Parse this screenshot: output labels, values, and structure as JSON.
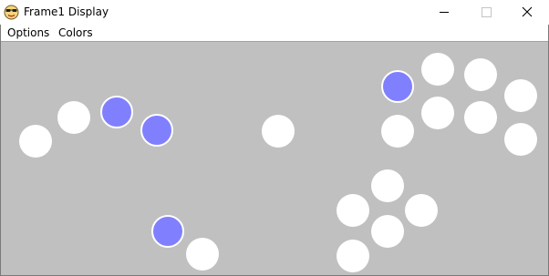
{
  "window": {
    "title": "Frame1 Display",
    "app_icon": "sunglasses-smiley-icon",
    "controls": {
      "minimize_icon": "minimize-icon",
      "maximize_icon": "maximize-icon",
      "close_icon": "close-icon"
    }
  },
  "menu": {
    "options_label": "Options",
    "colors_label": "Colors"
  },
  "canvas": {
    "background_color": "#c0c0c0",
    "ball_colors": {
      "white": "#ffffff",
      "blue": "#8080ff"
    }
  }
}
